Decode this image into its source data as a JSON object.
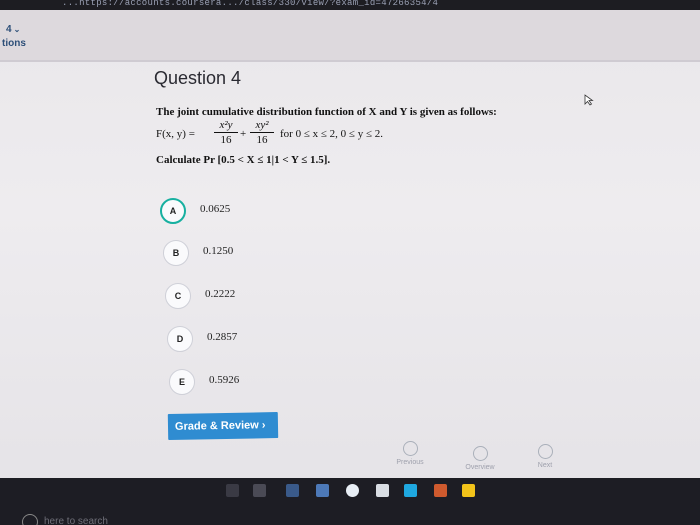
{
  "browser": {
    "url_text": "...https://accounts.coursera.../class/330/view/?exam_id=47266354/4"
  },
  "top": {
    "question_indicator": "4",
    "section_label": "tions"
  },
  "question": {
    "title": "Question 4",
    "prompt": "The joint cumulative distribution function of X and Y is given as follows:",
    "formula_lhs": "F(x, y) =",
    "frac1_num": "x²y",
    "frac1_den": "16",
    "plus": "+",
    "frac2_num": "xy²",
    "frac2_den": "16",
    "domain": "for 0 ≤ x ≤ 2,  0 ≤ y ≤ 2.",
    "calculate": "Calculate  Pr [0.5 < X ≤ 1|1 < Y ≤ 1.5]."
  },
  "options": [
    {
      "letter": "A",
      "value": "0.0625",
      "selected": true
    },
    {
      "letter": "B",
      "value": "0.1250",
      "selected": false
    },
    {
      "letter": "C",
      "value": "0.2222",
      "selected": false
    },
    {
      "letter": "D",
      "value": "0.2857",
      "selected": false
    },
    {
      "letter": "E",
      "value": "0.5926",
      "selected": false
    }
  ],
  "actions": {
    "grade_review": "Grade & Review ›"
  },
  "navigation": {
    "previous": "Previous",
    "overview": "Overview",
    "next": "Next"
  },
  "taskbar": {
    "search_placeholder": "here to search"
  },
  "colors": {
    "accent": "#17b0a0",
    "button": "#2f8cd1",
    "title": "#2d4f78"
  }
}
